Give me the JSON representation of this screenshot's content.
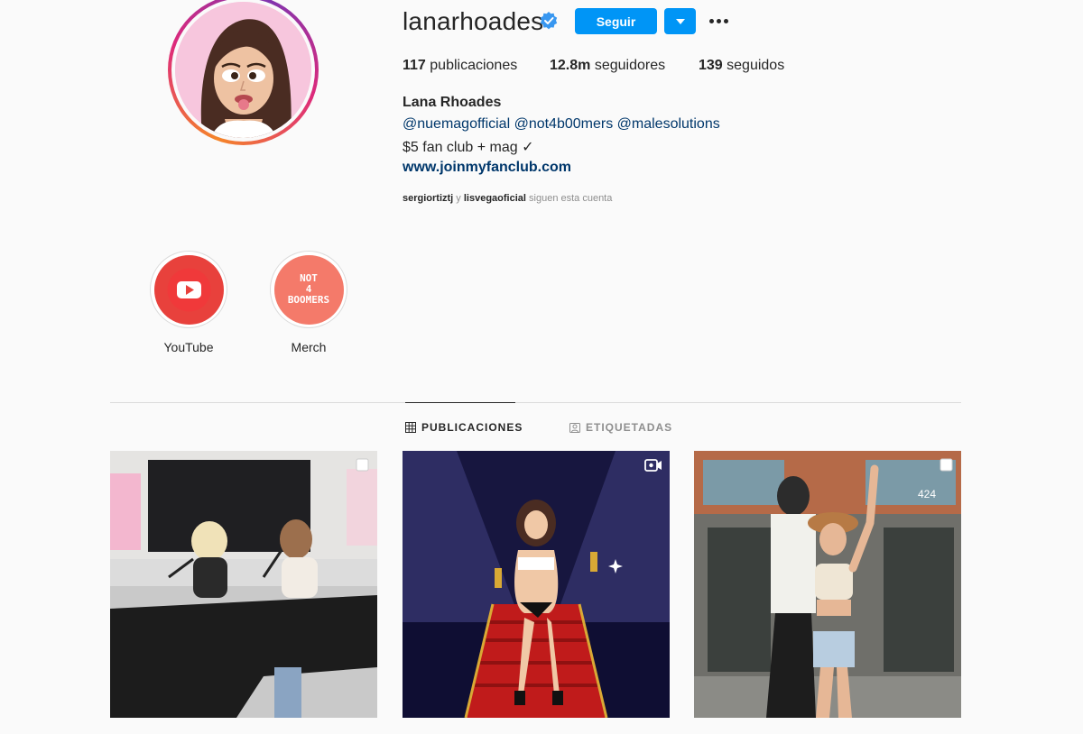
{
  "profile": {
    "username": "lanarhoades",
    "verified_icon": "verified-badge-icon",
    "follow_label": "Seguir",
    "dropdown_icon": "caret-down-icon",
    "more_icon": "more-dots-icon",
    "stats": {
      "posts_count": "117",
      "posts_label": "publicaciones",
      "followers_count": "12.8m",
      "followers_label": "seguidores",
      "following_count": "139",
      "following_label": "seguidos"
    },
    "full_name": "Lana Rhoades",
    "mentions": "@nuemagofficial @not4b00mers @malesolutions",
    "bio": "$5 fan club + mag ✓",
    "website": "www.joinmyfanclub.com",
    "followed_by": {
      "user1": "sergiortiztj",
      "connector": "y",
      "user2": "lisvegaoficial",
      "suffix": "siguen esta cuenta"
    }
  },
  "highlights": [
    {
      "label": "YouTube",
      "icon": "youtube-icon",
      "color": "#e8413c"
    },
    {
      "label": "Merch",
      "cover_text": [
        "NOT",
        "4",
        "BOOMERS"
      ],
      "color": "#f47a6a"
    }
  ],
  "tabs": [
    {
      "label": "PUBLICACIONES",
      "icon": "grid-icon",
      "active": true
    },
    {
      "label": "ETIQUETADAS",
      "icon": "tagged-icon",
      "active": false
    }
  ],
  "posts": [
    {
      "type": "carousel",
      "badge_icon": "carousel-icon"
    },
    {
      "type": "reel",
      "badge_icon": "reel-icon"
    },
    {
      "type": "carousel",
      "badge_icon": "carousel-icon",
      "sign_text": "424"
    }
  ],
  "colors": {
    "accent": "#0095f6",
    "link": "#00376b",
    "text": "#262626",
    "muted": "#8e8e8e",
    "background": "#fafafa"
  }
}
